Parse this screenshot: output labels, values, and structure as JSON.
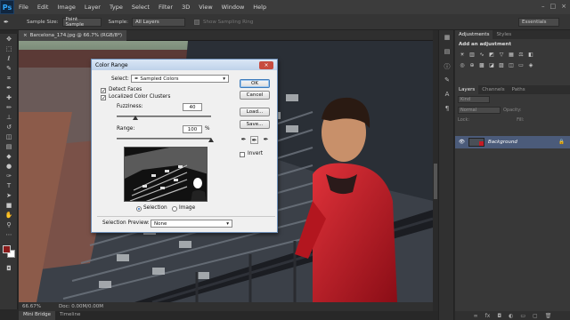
{
  "app": {
    "logo": "Ps"
  },
  "menu": [
    "File",
    "Edit",
    "Image",
    "Layer",
    "Type",
    "Select",
    "Filter",
    "3D",
    "View",
    "Window",
    "Help"
  ],
  "window_controls": [
    "–",
    "□",
    "×"
  ],
  "options": {
    "sample_size_label": "Sample Size:",
    "sample_size_value": "Point Sample",
    "sample_label": "Sample:",
    "sample_value": "All Layers",
    "show_ring": "Show Sampling Ring",
    "workspace": "Essentials"
  },
  "document": {
    "tab_title": "Barcelona_174.jpg @ 66.7% (RGB/8*)",
    "zoom": "66.67%",
    "doc_size": "Doc: 0.00M/0.00M"
  },
  "bottom_tabs": [
    "Mini Bridge",
    "Timeline"
  ],
  "panels": {
    "top_tabs": [
      "Adjustments",
      "Styles"
    ],
    "adj_title": "Add an adjustment",
    "layer_tabs": [
      "Layers",
      "Channels",
      "Paths"
    ],
    "kind_label": "Kind",
    "blend_mode": "Normal",
    "opacity_label": "Opacity:",
    "lock_label": "Lock:",
    "fill_label": "Fill:",
    "layer_name": "Background"
  },
  "dialog": {
    "title": "Color Range",
    "close": "×",
    "select_label": "Select:",
    "select_value": "Sampled Colors",
    "detect_faces": "Detect Faces",
    "localized": "Localized Color Clusters",
    "fuzziness_label": "Fuzziness:",
    "fuzziness_value": "40",
    "range_label": "Range:",
    "range_value": "100",
    "range_unit": "%",
    "fuzziness_fraction": 0.2,
    "range_fraction": 1.0,
    "radio_selection": "Selection",
    "radio_image": "Image",
    "preview_label": "Selection Preview:",
    "preview_value": "None",
    "buttons": {
      "ok": "OK",
      "cancel": "Cancel",
      "load": "Load...",
      "save": "Save..."
    },
    "invert": "Invert"
  },
  "colors": {
    "accent": "#31a8ff",
    "jacket": "#c41b26",
    "layer_selected": "#4b5b7a"
  }
}
